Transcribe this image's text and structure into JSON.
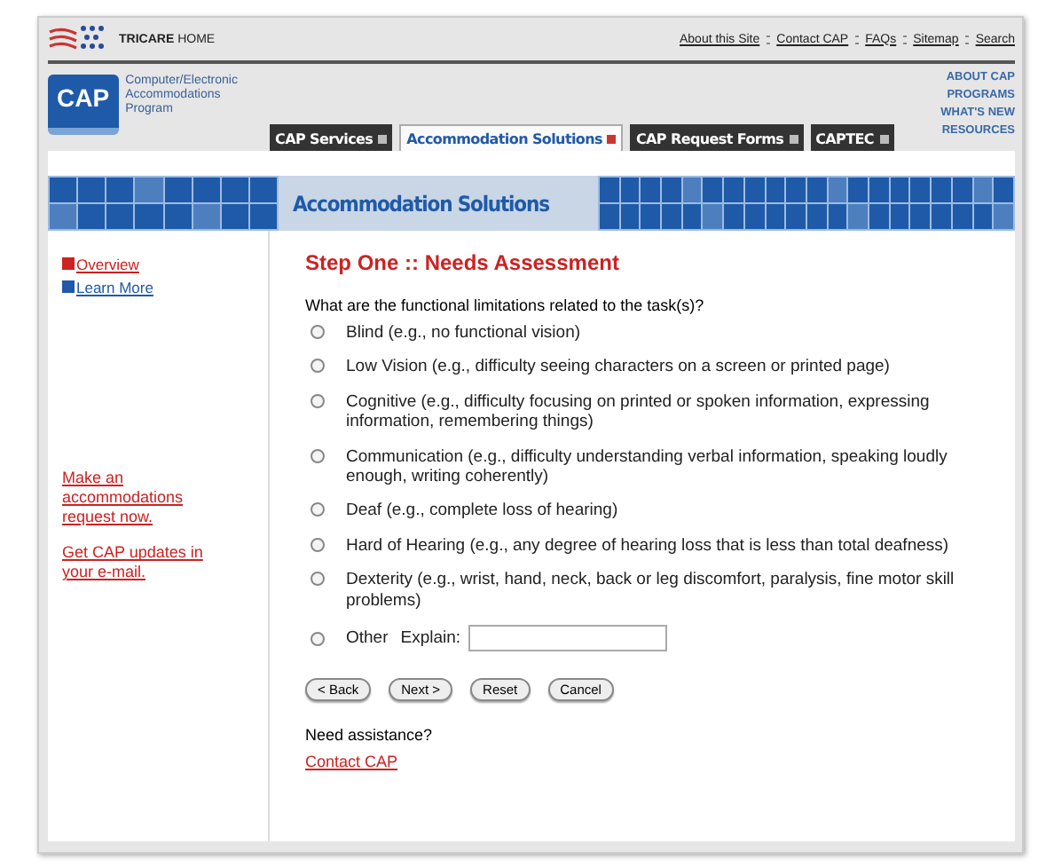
{
  "header": {
    "home_label": "TRICARE",
    "home_suffix": "HOME",
    "top_links": [
      "About this Site",
      "Contact CAP",
      "FAQs",
      "Sitemap",
      "Search"
    ],
    "logo_text": "CAP",
    "program_name": "Computer/Electronic Accommodations Program",
    "side_links": [
      "ABOUT CAP",
      "PROGRAMS",
      "WHAT'S NEW",
      "RESOURCES"
    ]
  },
  "tabs": [
    {
      "label": "CAP Services",
      "selected": false
    },
    {
      "label": "Accommodation Solutions",
      "selected": true
    },
    {
      "label": "CAP Request Forms",
      "selected": false
    },
    {
      "label": "CAPTEC",
      "selected": false
    }
  ],
  "banner": {
    "title": "Accommodation Solutions"
  },
  "sidebar": {
    "items": [
      {
        "label": "Overview",
        "color": "#cc2222"
      },
      {
        "label": "Learn More",
        "color": "#1f5aa8"
      }
    ],
    "promo_links": [
      "Make an accommodations request now.",
      "Get CAP updates in your e-mail."
    ]
  },
  "form": {
    "title": "Step One :: Needs Assessment",
    "question": "What are the functional limitations related to the task(s)?",
    "options": [
      {
        "label": "Blind (e.g., no functional vision)",
        "selected": false
      },
      {
        "label": "Low Vision (e.g., difficulty seeing characters on a screen or printed page)",
        "selected": false
      },
      {
        "label": "Cognitive (e.g., difficulty focusing on printed or spoken information, expressing information, remembering things)",
        "selected": false
      },
      {
        "label": "Communication (e.g., difficulty understanding verbal information, speaking loudly enough, writing coherently)",
        "selected": false
      },
      {
        "label": "Deaf (e.g., complete loss of hearing)",
        "selected": false
      },
      {
        "label": "Hard of Hearing (e.g., any degree of hearing loss that is less than total deafness)",
        "selected": false
      },
      {
        "label": "Dexterity (e.g., wrist, hand, neck, back or leg discomfort, paralysis, fine motor skill problems)",
        "selected": false
      }
    ],
    "other": {
      "label": "Other",
      "explain_label": "Explain:",
      "selected": false
    },
    "buttons": [
      "< Back",
      "Next >",
      "Reset",
      "Cancel"
    ],
    "help_text": "Need assistance?",
    "help_link": "Contact CAP"
  }
}
